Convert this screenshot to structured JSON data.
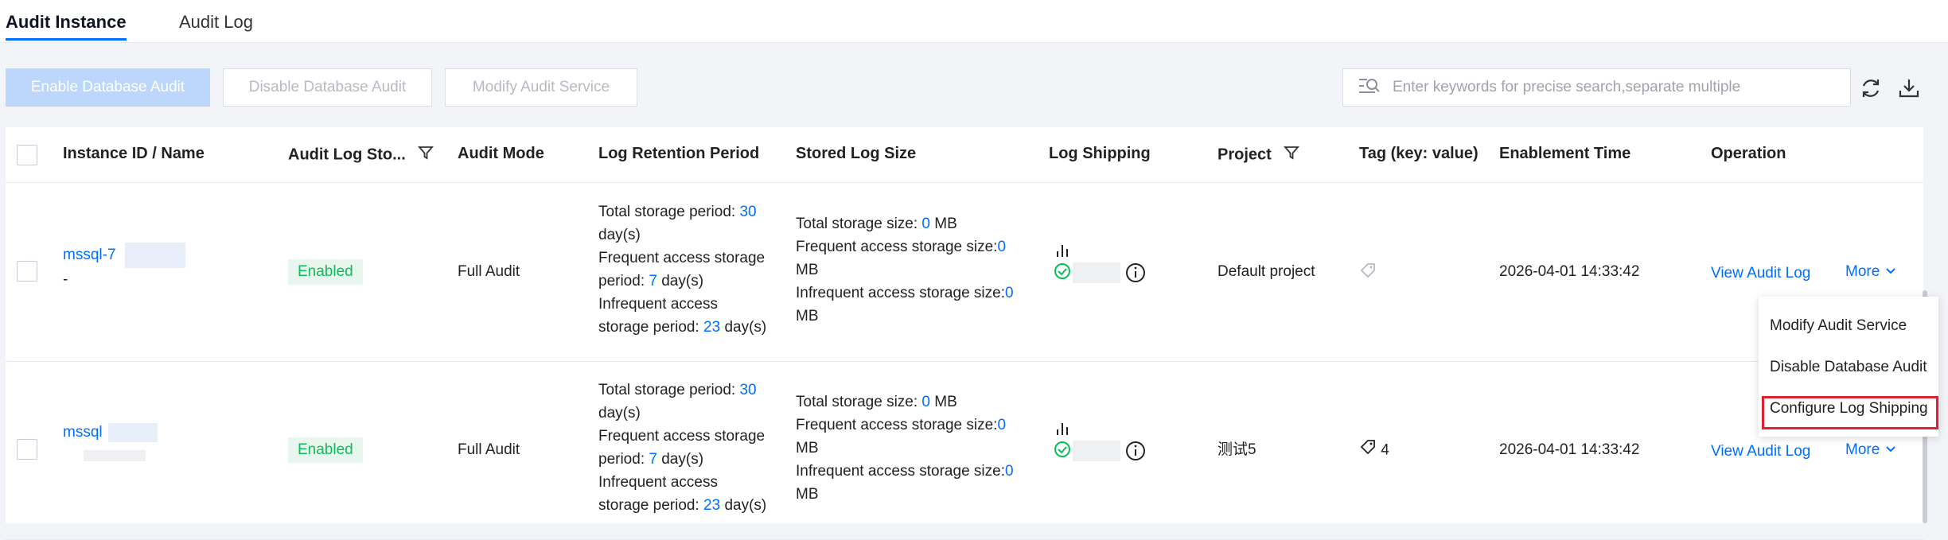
{
  "tabs": [
    {
      "label": "Audit Instance",
      "active": true
    },
    {
      "label": "Audit Log",
      "active": false
    }
  ],
  "toolbar": {
    "enable_label": "Enable Database Audit",
    "disable_label": "Disable Database Audit",
    "modify_label": "Modify Audit Service",
    "search_placeholder": "Enter keywords for precise search,separate multiple"
  },
  "columns": {
    "instance": "Instance ID / Name",
    "audit_log_storage": "Audit Log Sto...",
    "audit_mode": "Audit Mode",
    "retention": "Log Retention Period",
    "stored_size": "Stored Log Size",
    "shipping": "Log Shipping",
    "project": "Project",
    "tag": "Tag (key: value)",
    "enable_time": "Enablement Time",
    "operation": "Operation"
  },
  "rows": [
    {
      "instance_id": "mssql-7",
      "instance_name": "-",
      "status": "Enabled",
      "audit_mode": "Full Audit",
      "retention_total_label": "Total storage period: ",
      "retention_total": "30",
      "retention_days": "day(s)",
      "retention_frequent_label": "Frequent access storage period: ",
      "retention_frequent": "7",
      "retention_frequent_unit": " day(s)",
      "retention_infrequent_label_1": "Infrequent access",
      "retention_infrequent_label_2": "storage period: ",
      "retention_infrequent": "23",
      "retention_infrequent_unit": " day(s)",
      "size_total_label": "Total storage size: ",
      "size_total": "0",
      "size_unit": " MB",
      "size_frequent_label": "Frequent access storage size:",
      "size_frequent": "0",
      "size_frequent_unit": "MB",
      "size_infrequent_label": "Infrequent access storage size:",
      "size_infrequent": "0",
      "size_infrequent_unit": "MB",
      "project": "Default project",
      "tag_count": "",
      "enable_time": "2026-04-01 14:33:42",
      "view_log": "View Audit Log",
      "more": "More"
    },
    {
      "instance_id": "mssql",
      "instance_name": "",
      "status": "Enabled",
      "audit_mode": "Full Audit",
      "retention_total_label": "Total storage period: ",
      "retention_total": "30",
      "retention_days": "day(s)",
      "retention_frequent_label": "Frequent access storage period: ",
      "retention_frequent": "7",
      "retention_frequent_unit": " day(s)",
      "retention_infrequent_label_1": "Infrequent access",
      "retention_infrequent_label_2": "storage period: ",
      "retention_infrequent": "23",
      "retention_infrequent_unit": " day(s)",
      "size_total_label": "Total storage size: ",
      "size_total": "0",
      "size_unit": " MB",
      "size_frequent_label": "Frequent access storage size:",
      "size_frequent": "0",
      "size_frequent_unit": "MB",
      "size_infrequent_label": "Infrequent access storage size:",
      "size_infrequent": "0",
      "size_infrequent_unit": "MB",
      "project": "测试5",
      "tag_count": "4",
      "enable_time": "2026-04-01 14:33:42",
      "view_log": "View Audit Log",
      "more": "More"
    }
  ],
  "dropdown": {
    "items": [
      "Modify Audit Service",
      "Disable Database Audit",
      "Configure Log Shipping"
    ]
  },
  "colors": {
    "accent": "#006eff",
    "success": "#0abf5b",
    "highlight": "#e0202e"
  }
}
